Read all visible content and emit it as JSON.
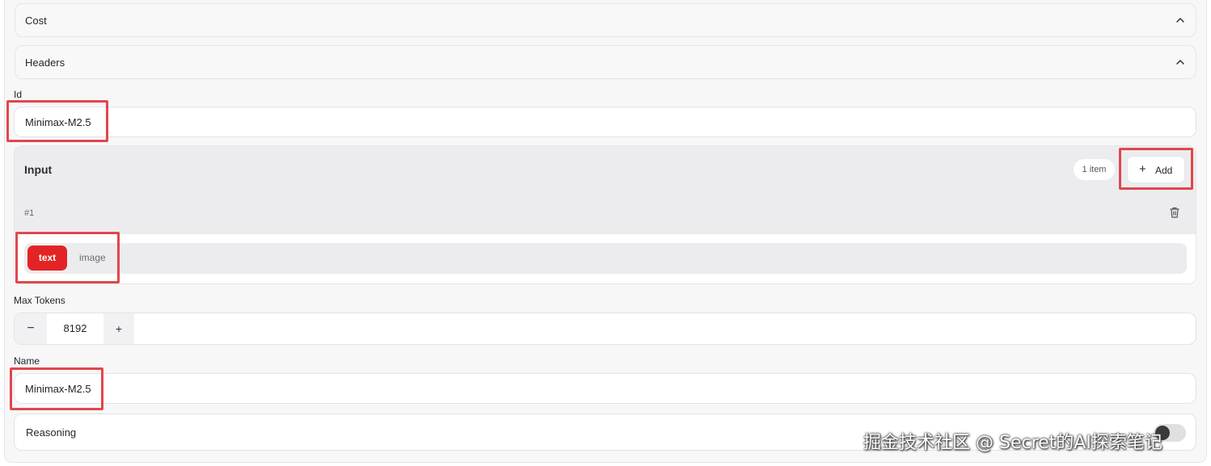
{
  "cost": {
    "title": "Cost"
  },
  "headers": {
    "title": "Headers"
  },
  "id_field": {
    "label": "Id",
    "value": "Minimax-M2.5"
  },
  "input": {
    "title": "Input",
    "count": "1 item",
    "add_label": "Add",
    "item": {
      "number": "#1",
      "options": [
        "text",
        "image"
      ],
      "selected": "text"
    }
  },
  "max_tokens": {
    "label": "Max Tokens",
    "value": "8192",
    "minus": "−",
    "plus": "+"
  },
  "name_field": {
    "label": "Name",
    "value": "Minimax-M2.5"
  },
  "reasoning": {
    "title": "Reasoning"
  },
  "watermark": "掘金技术社区 @ Secret的AI探索笔记",
  "colors": {
    "accent": "#e32424",
    "highlight": "#e0474c"
  }
}
